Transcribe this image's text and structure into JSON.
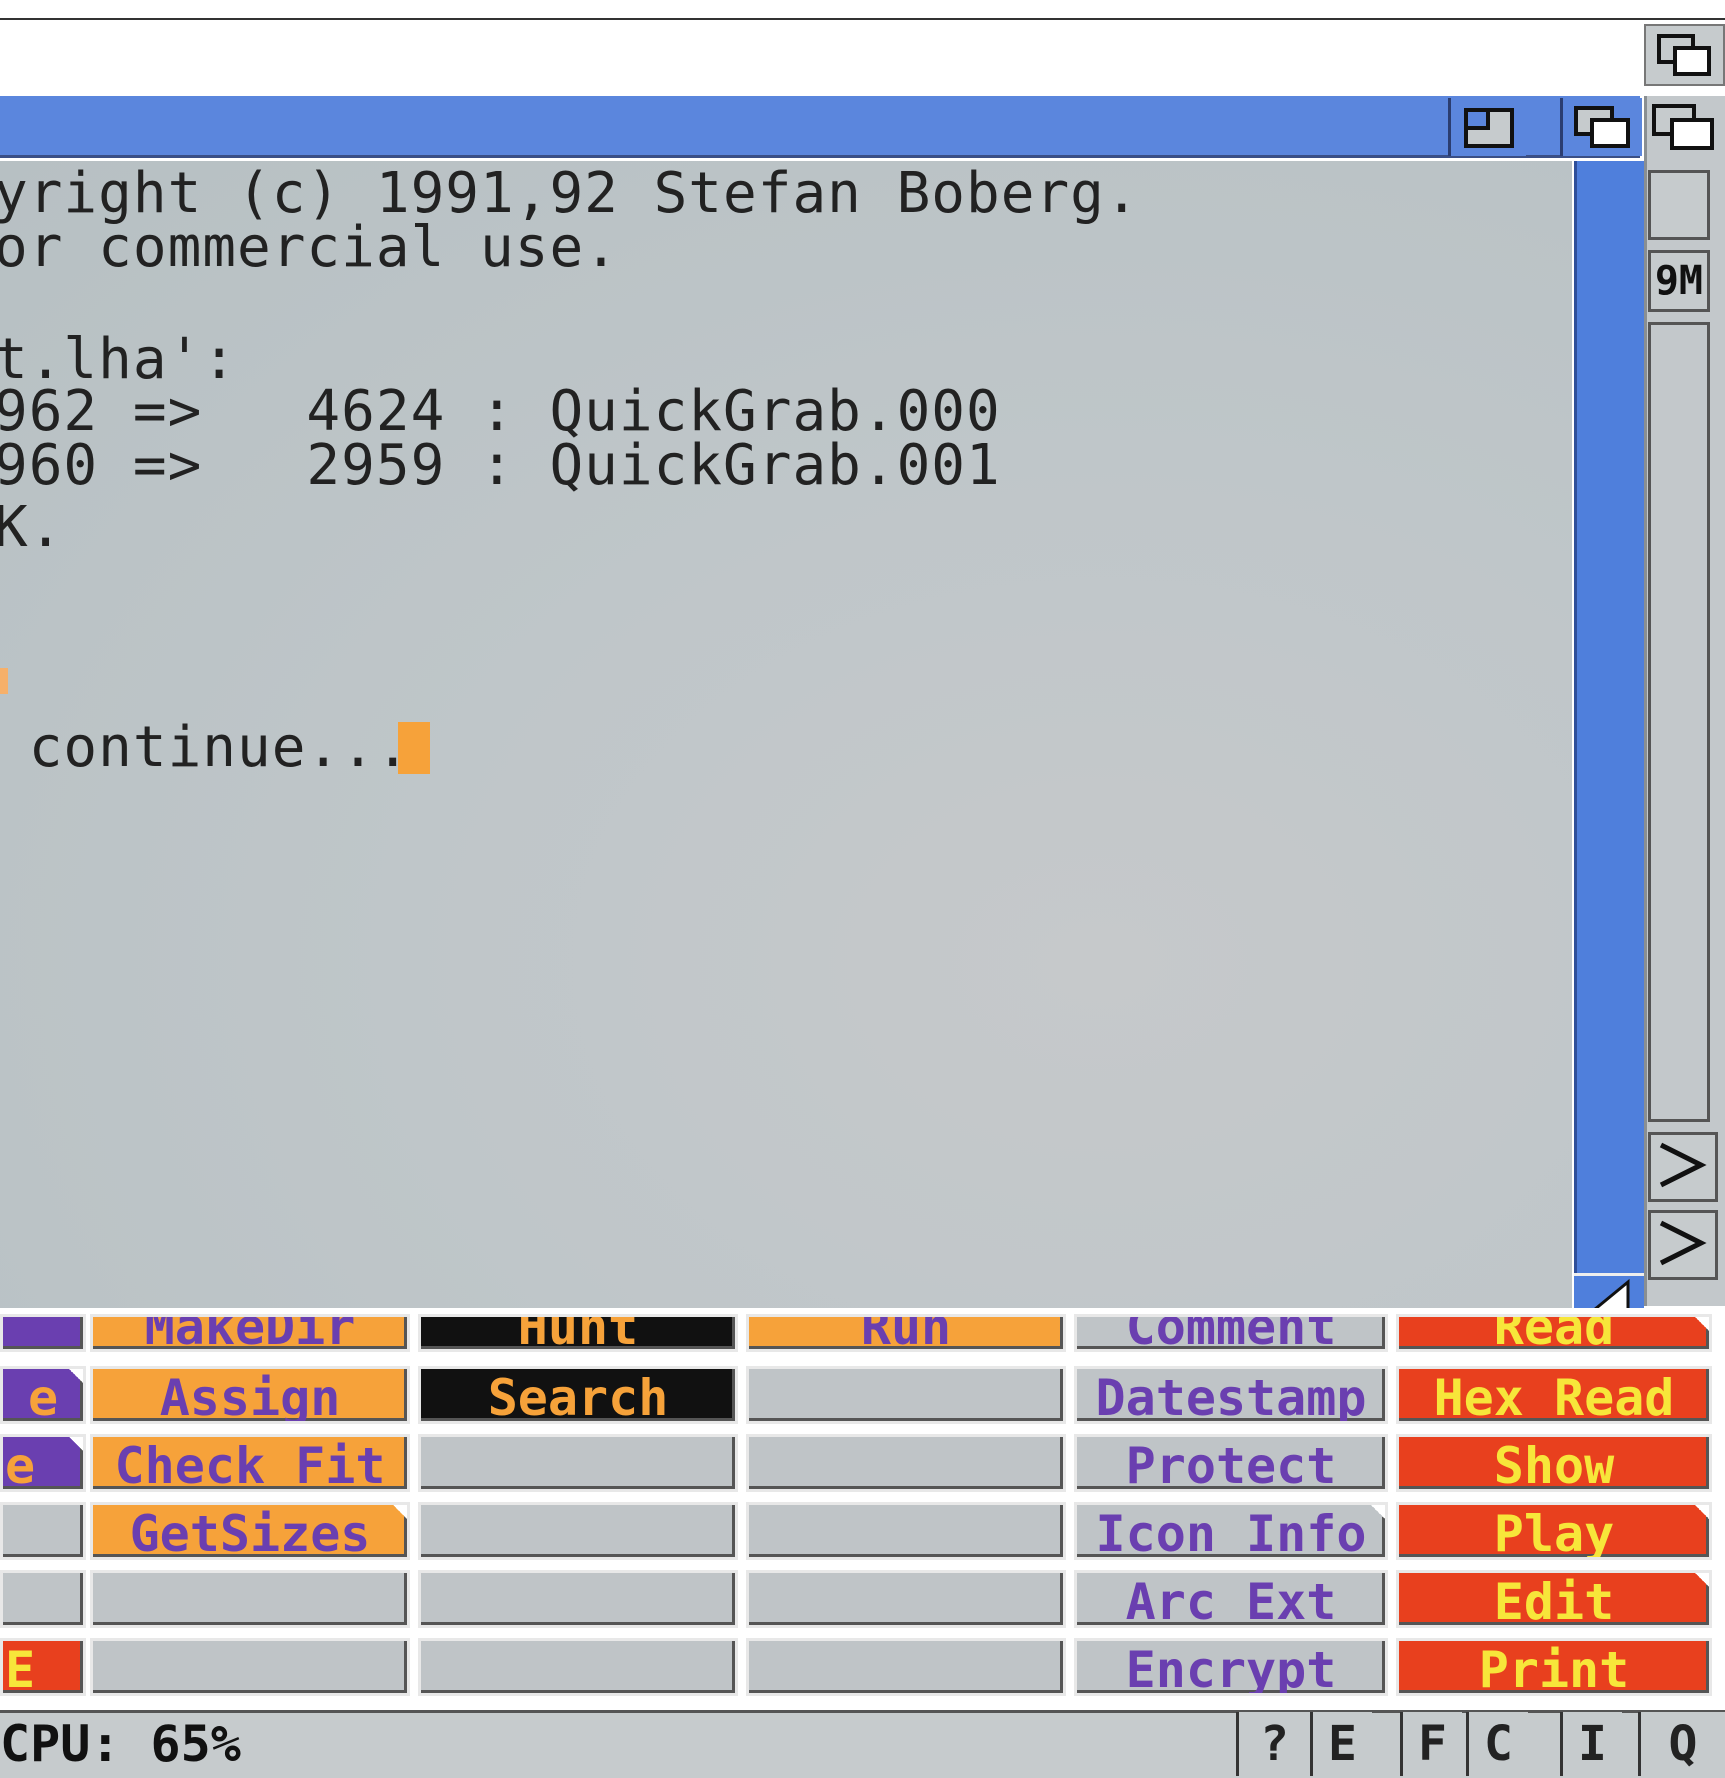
{
  "console": {
    "lines": [
      "yright (c) 1991,92 Stefan Boberg.",
      "or commercial use.",
      "",
      "t.lha':",
      "962 =>   4624 : QuickGrab.000",
      "960 =>   2959 : QuickGrab.001",
      "K.",
      "",
      "",
      " continue..."
    ]
  },
  "right_column": {
    "device_label": "9M"
  },
  "button_bank": {
    "col1": [
      "",
      "e",
      "",
      "",
      "E"
    ],
    "col2": [
      "MakeDir",
      "Assign",
      "Check Fit",
      "GetSizes",
      "",
      ""
    ],
    "col3": [
      "Hunt",
      "Search",
      "",
      "",
      "",
      ""
    ],
    "col4": [
      "Run",
      "",
      "",
      "",
      "",
      ""
    ],
    "col5": [
      "Comment",
      "Datestamp",
      "Protect",
      "Icon Info",
      "Arc Ext",
      "Encrypt"
    ],
    "col6": [
      "Read",
      "Hex Read",
      "Show",
      "Play",
      "Edit",
      "Print"
    ]
  },
  "status": {
    "cpu_label": "CPU: 65%",
    "buttons": [
      "?",
      "E",
      "F",
      "C",
      "I",
      "Q"
    ]
  },
  "colors": {
    "window_blue": "#5b86dd",
    "console_bg": "#c0c6c9",
    "cursor_orange": "#f6a23a",
    "button_red": "#e8401e",
    "text_yellow": "#f7e63a",
    "text_purple": "#6a3fb0"
  }
}
